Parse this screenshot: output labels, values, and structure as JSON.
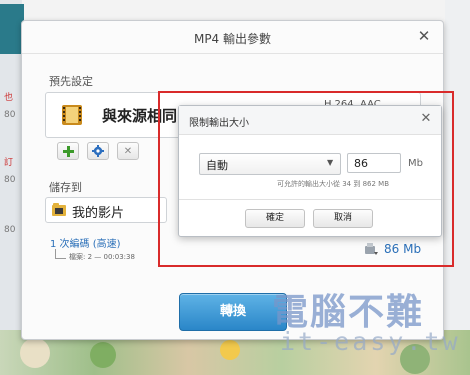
{
  "background": {
    "fragments": [
      "也",
      "80",
      "訂",
      "80",
      "80"
    ]
  },
  "dialog": {
    "title": "MP4 輸出參數",
    "presets_label": "預先設定",
    "preset_name": "與來源相同",
    "preset_codec": "H.264, AAC",
    "save_to_label": "儲存到",
    "destination": "我的影片",
    "pass_mode": "1 次編碼 (高速)",
    "file_info": "檔案: 2 — 00:03:38",
    "estimated_size": "86 Mb",
    "convert_label": "轉換"
  },
  "popup": {
    "title": "限制輸出大小",
    "mode_value": "自動",
    "size_value": "86",
    "unit": "Mb",
    "range_note": "可允許的輸出大小從 34 到 862 MB",
    "ok_label": "確定",
    "cancel_label": "取消"
  },
  "watermark": {
    "text_cn": "電腦不難",
    "text_en": "it-easy.tw"
  },
  "colors": {
    "accent": "#2a86c8",
    "highlight": "#d92b2b",
    "link": "#2a6fb8"
  }
}
